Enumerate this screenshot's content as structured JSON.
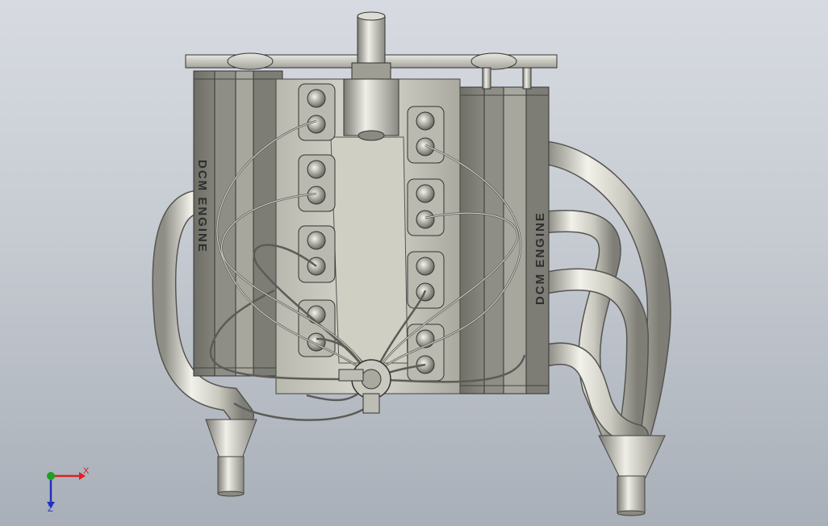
{
  "model": {
    "left_bank_label": "DCM ENGINE",
    "right_bank_label": "DCM ENGINE"
  },
  "triad": {
    "x_label": "X",
    "z_label": "Z",
    "x_color": "#e02020",
    "y_color": "#20a020",
    "z_color": "#2030c0"
  }
}
